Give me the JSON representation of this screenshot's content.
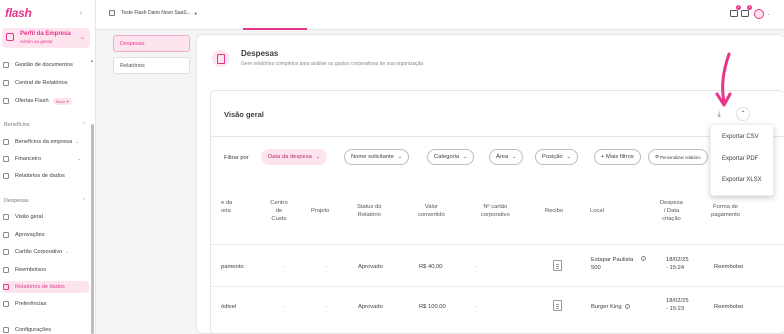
{
  "sidebar": {
    "logo": "flash",
    "profile": {
      "name": "Perfil da Empresa",
      "role": "Admin ou gestor"
    },
    "items": [
      {
        "label": "Gestão de documentos"
      },
      {
        "label": "Central de Relatórios"
      },
      {
        "label": "Ofertas Flash",
        "badge": "Novo ✦"
      }
    ],
    "section_beneficios": "Benefícios",
    "beneficios_items": [
      {
        "label": "Benefícios da empresa"
      },
      {
        "label": "Financeiro"
      },
      {
        "label": "Relatórios de dados"
      }
    ],
    "section_despesas": "Despesas",
    "despesas_items": [
      {
        "label": "Visão geral"
      },
      {
        "label": "Aprovações"
      },
      {
        "label": "Cartão Corporativo"
      },
      {
        "label": "Reembolsos"
      },
      {
        "label": "Relatórios de dados"
      },
      {
        "label": "Preferências"
      },
      {
        "label": "Configurações"
      }
    ]
  },
  "topbar": {
    "company": "Teste Flash Dario Novo SaaS...",
    "notifications_count": "3",
    "messages_count": "3"
  },
  "submenu": {
    "item1": "Despesas",
    "item2": "Relatórios"
  },
  "header": {
    "title": "Despesas",
    "subtitle": "Gere relatórios completos para análise os gastos corporativos de sua organização."
  },
  "overview": {
    "title": "Visão geral"
  },
  "filters": {
    "label": "Filtrar por",
    "chips": [
      "Data da despesa",
      "Nome solicitante",
      "Categoria",
      "Área",
      "Posição",
      "+ Mais filtros",
      "Personalizar relatório"
    ]
  },
  "table": {
    "headers": [
      "e da\noria",
      "Centro\nde\nCusto",
      "Projeto",
      "Status do\nRelatório",
      "Valor\nconvertido",
      "Nº cartão\ncorporativo",
      "Recibo",
      "Local",
      "Despesa\n/ Data\ncriação",
      "Forma de\npagamento"
    ],
    "rows": [
      {
        "categoria": "pamento",
        "centro": "-",
        "projeto": "-",
        "status": "Aprovado",
        "valor": "R$ 40,00",
        "cartao": "-",
        "local": "Estapar Paulista 500",
        "data": "18/02/25\n- 15:24",
        "forma": "Reembolso"
      },
      {
        "categoria": "ódivel",
        "centro": "-",
        "projeto": "-",
        "status": "Aprovado",
        "valor": "R$ 100,00",
        "cartao": "-",
        "local": "Burger King",
        "data": "18/02/25\n- 15:23",
        "forma": "Reembolso"
      }
    ]
  },
  "export_menu": {
    "items": [
      "Exportar CSV",
      "Exportar PDF",
      "Exportar XLSX"
    ]
  },
  "colors": {
    "accent": "#e8358c",
    "accent_light": "#fde4ef"
  }
}
